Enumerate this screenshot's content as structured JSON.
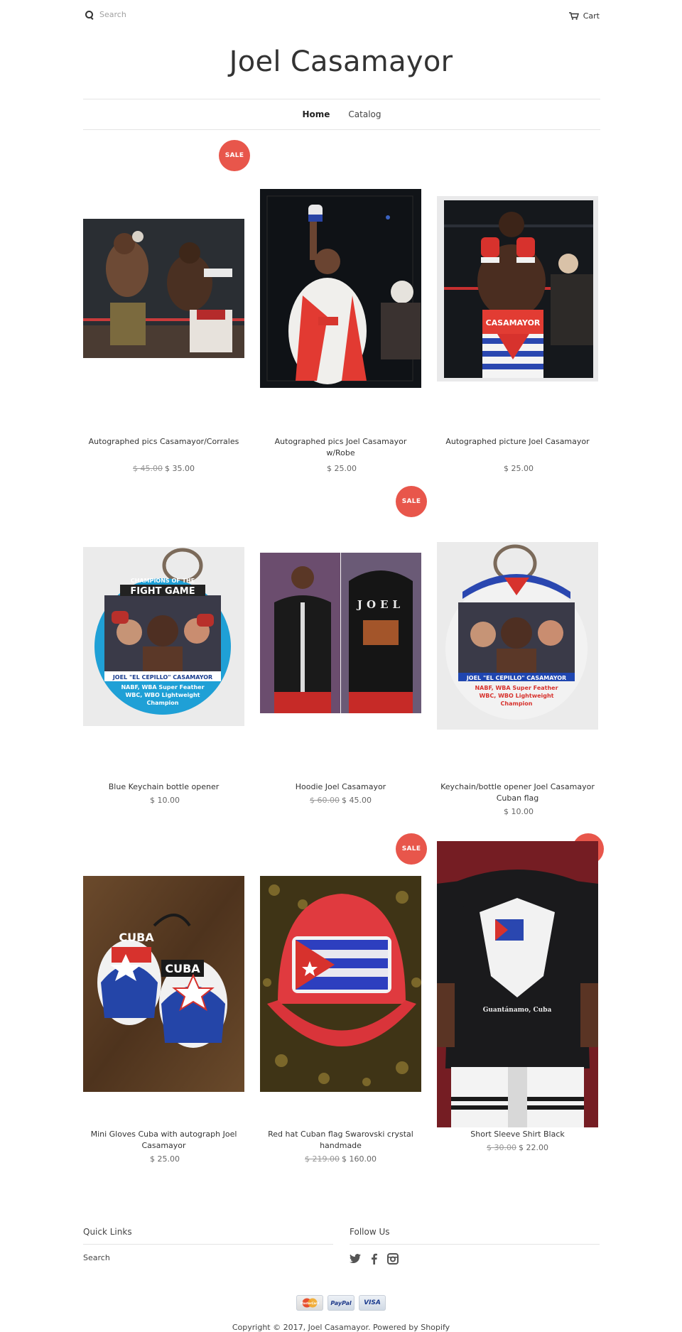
{
  "header": {
    "search_placeholder": "Search",
    "cart_label": "Cart",
    "site_title": "Joel Casamayor"
  },
  "nav": {
    "items": [
      {
        "label": "Home",
        "active": true
      },
      {
        "label": "Catalog",
        "active": false
      }
    ]
  },
  "sale_label": "SALE",
  "products": [
    {
      "name": "Autographed pics Casamayor/Corrales",
      "old_price": "$ 45.00",
      "price": "$ 35.00",
      "sale": true
    },
    {
      "name": "Autographed pics Joel Casamayor w/Robe",
      "old_price": "",
      "price": "$ 25.00",
      "sale": false
    },
    {
      "name": "Autographed picture Joel Casamayor",
      "old_price": "",
      "price": "$ 25.00",
      "sale": false
    },
    {
      "name": "Blue Keychain bottle opener",
      "old_price": "",
      "price": "$ 10.00",
      "sale": false
    },
    {
      "name": "Hoodie Joel Casamayor",
      "old_price": "$ 60.00",
      "price": "$ 45.00",
      "sale": true
    },
    {
      "name": "Keychain/bottle opener Joel Casamayor Cuban flag",
      "old_price": "",
      "price": "$ 10.00",
      "sale": false
    },
    {
      "name": "Mini Gloves Cuba with autograph Joel Casamayor",
      "old_price": "",
      "price": "$ 25.00",
      "sale": false
    },
    {
      "name": "Red hat Cuban flag Swarovski crystal handmade",
      "old_price": "$ 219.00",
      "price": "$ 160.00",
      "sale": true
    },
    {
      "name": "Short Sleeve Shirt Black",
      "old_price": "$ 30.00",
      "price": "$ 22.00",
      "sale": true
    }
  ],
  "image_text": {
    "keychain_blue_top": "CHAMPIONS OF THE",
    "keychain_blue_title": "FIGHT GAME",
    "keychain_blue_name": "JOEL \"EL CEPILLO\" CASAMAYOR",
    "keychain_blue_l1": "NABF, WBA Super Feather",
    "keychain_blue_l2": "WBC, WBO Lightweight",
    "keychain_blue_l3": "Champion",
    "keychain_flag_name": "JOEL \"EL CEPILLO\" CASAMAYOR",
    "keychain_flag_l1": "NABF, WBA Super Feather",
    "keychain_flag_l2": "WBC, WBO Lightweight",
    "keychain_flag_l3": "Champion",
    "trunks_text": "CASAMAYOR",
    "hoodie_text": "JOEL",
    "glove_left": "CUBA",
    "glove_right": "CUBA",
    "shirt_text": "Guantánamo, Cuba"
  },
  "footer": {
    "quick_links_title": "Quick Links",
    "quick_links": [
      "Search"
    ],
    "follow_title": "Follow Us",
    "social_icons": [
      "twitter-icon",
      "facebook-icon",
      "instagram-icon"
    ],
    "payments": [
      "MasterCard",
      "PayPal",
      "VISA"
    ],
    "copyright": "Copyright © 2017, Joel Casamayor. Powered by Shopify"
  },
  "colors": {
    "sale_badge": "#e8564b",
    "divider": "#e4e4e4",
    "text": "#333333"
  }
}
